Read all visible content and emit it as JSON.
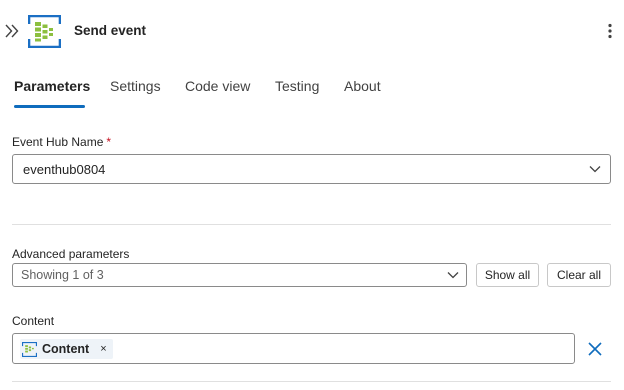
{
  "header": {
    "title": "Send event",
    "icon": "event-hub-icon",
    "accent": "#0f6cbd"
  },
  "tabs": [
    {
      "label": "Parameters",
      "active": true
    },
    {
      "label": "Settings",
      "active": false
    },
    {
      "label": "Code view",
      "active": false
    },
    {
      "label": "Testing",
      "active": false
    },
    {
      "label": "About",
      "active": false
    }
  ],
  "event_hub": {
    "label": "Event Hub Name",
    "required_mark": "*",
    "value": "eventhub0804"
  },
  "advanced": {
    "label": "Advanced parameters",
    "value": "Showing 1 of 3",
    "show_all": "Show all",
    "clear_all": "Clear all"
  },
  "content": {
    "label": "Content",
    "token_label": "Content",
    "token_remove": "×"
  }
}
